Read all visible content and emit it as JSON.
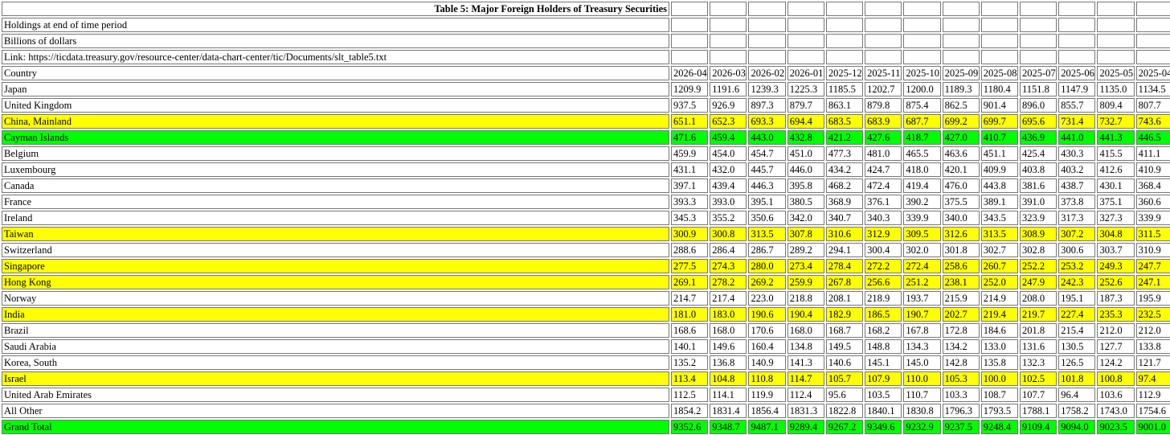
{
  "table": {
    "title": "Table 5: Major Foreign Holders of Treasury Securities",
    "meta": [
      "Holdings at end of time period",
      "Billions of dollars",
      "Link: https://ticdata.treasury.gov/resource-center/data-chart-center/tic/Documents/slt_table5.txt"
    ],
    "header_first": "Country",
    "columns": [
      "2026-04",
      "2026-03",
      "2026-02",
      "2026-01",
      "2025-12",
      "2025-11",
      "2025-10",
      "2025-09",
      "2025-08",
      "2025-07",
      "2025-06",
      "2025-05",
      "2025-04"
    ],
    "highlight_colors": {
      "yellow": "#ffff00",
      "green": "#00ff00"
    },
    "rows": [
      {
        "country": "Japan",
        "highlight": "none",
        "values": [
          "1209.9",
          "1191.6",
          "1239.3",
          "1225.3",
          "1185.5",
          "1202.7",
          "1200.0",
          "1189.3",
          "1180.4",
          "1151.8",
          "1147.9",
          "1135.0",
          "1134.5"
        ]
      },
      {
        "country": "United Kingdom",
        "highlight": "none",
        "values": [
          "937.5",
          "926.9",
          "897.3",
          "879.7",
          "863.1",
          "879.8",
          "875.4",
          "862.5",
          "901.4",
          "896.0",
          "855.7",
          "809.4",
          "807.7"
        ]
      },
      {
        "country": "China, Mainland",
        "highlight": "yellow",
        "values": [
          "651.1",
          "652.3",
          "693.3",
          "694.4",
          "683.5",
          "683.9",
          "687.7",
          "699.2",
          "699.7",
          "695.6",
          "731.4",
          "732.7",
          "743.6"
        ]
      },
      {
        "country": "Cayman Islands",
        "highlight": "green",
        "values": [
          "471.6",
          "459.4",
          "443.0",
          "432.8",
          "421.2",
          "427.6",
          "418.7",
          "427.0",
          "410.7",
          "436.9",
          "441.0",
          "441.3",
          "446.5"
        ]
      },
      {
        "country": "Belgium",
        "highlight": "none",
        "values": [
          "459.9",
          "454.0",
          "454.7",
          "451.0",
          "477.3",
          "481.0",
          "465.5",
          "463.6",
          "451.1",
          "425.4",
          "430.3",
          "415.5",
          "411.1"
        ]
      },
      {
        "country": "Luxembourg",
        "highlight": "none",
        "values": [
          "431.1",
          "432.0",
          "445.7",
          "446.0",
          "434.2",
          "424.7",
          "418.0",
          "420.1",
          "409.9",
          "403.8",
          "403.2",
          "412.6",
          "410.9"
        ]
      },
      {
        "country": "Canada",
        "highlight": "none",
        "values": [
          "397.1",
          "439.4",
          "446.3",
          "395.8",
          "468.2",
          "472.4",
          "419.4",
          "476.0",
          "443.8",
          "381.6",
          "438.7",
          "430.1",
          "368.4"
        ]
      },
      {
        "country": "France",
        "highlight": "none",
        "values": [
          "393.3",
          "393.0",
          "395.1",
          "380.5",
          "368.9",
          "376.1",
          "390.2",
          "375.5",
          "389.1",
          "391.0",
          "373.8",
          "375.1",
          "360.6"
        ]
      },
      {
        "country": "Ireland",
        "highlight": "none",
        "values": [
          "345.3",
          "355.2",
          "350.6",
          "342.0",
          "340.7",
          "340.3",
          "339.9",
          "340.0",
          "343.5",
          "323.9",
          "317.3",
          "327.3",
          "339.9"
        ]
      },
      {
        "country": "Taiwan",
        "highlight": "yellow",
        "values": [
          "300.9",
          "300.8",
          "313.5",
          "307.8",
          "310.6",
          "312.9",
          "309.5",
          "312.6",
          "313.5",
          "308.9",
          "307.2",
          "304.8",
          "311.5"
        ]
      },
      {
        "country": "Switzerland",
        "highlight": "none",
        "values": [
          "288.6",
          "286.4",
          "286.7",
          "289.2",
          "294.1",
          "300.4",
          "302.0",
          "301.8",
          "302.7",
          "302.8",
          "300.6",
          "303.7",
          "310.9"
        ]
      },
      {
        "country": "Singapore",
        "highlight": "yellow",
        "values": [
          "277.5",
          "274.3",
          "280.0",
          "273.4",
          "278.4",
          "272.2",
          "272.4",
          "258.6",
          "260.7",
          "252.2",
          "253.2",
          "249.3",
          "247.7"
        ]
      },
      {
        "country": "Hong Kong",
        "highlight": "yellow",
        "values": [
          "269.1",
          "278.2",
          "269.2",
          "259.9",
          "267.8",
          "256.6",
          "251.2",
          "238.1",
          "252.0",
          "247.9",
          "242.3",
          "252.6",
          "247.1"
        ]
      },
      {
        "country": "Norway",
        "highlight": "none",
        "values": [
          "214.7",
          "217.4",
          "223.0",
          "218.8",
          "208.1",
          "218.9",
          "193.7",
          "215.9",
          "214.9",
          "208.0",
          "195.1",
          "187.3",
          "195.9"
        ]
      },
      {
        "country": "India",
        "highlight": "yellow",
        "values": [
          "181.0",
          "183.0",
          "190.6",
          "190.4",
          "182.9",
          "186.5",
          "190.7",
          "202.7",
          "219.4",
          "219.7",
          "227.4",
          "235.3",
          "232.5"
        ]
      },
      {
        "country": "Brazil",
        "highlight": "none",
        "values": [
          "168.6",
          "168.0",
          "170.6",
          "168.0",
          "168.7",
          "168.2",
          "167.8",
          "172.8",
          "184.6",
          "201.8",
          "215.4",
          "212.0",
          "212.0"
        ]
      },
      {
        "country": "Saudi Arabia",
        "highlight": "none",
        "values": [
          "140.1",
          "149.6",
          "160.4",
          "134.8",
          "149.5",
          "148.8",
          "134.3",
          "134.2",
          "133.0",
          "131.6",
          "130.5",
          "127.7",
          "133.8"
        ]
      },
      {
        "country": "Korea, South",
        "highlight": "none",
        "values": [
          "135.2",
          "136.8",
          "140.9",
          "141.3",
          "140.6",
          "145.1",
          "145.0",
          "142.8",
          "135.8",
          "132.3",
          "126.5",
          "124.2",
          "121.7"
        ]
      },
      {
        "country": "Israel",
        "highlight": "yellow",
        "values": [
          "113.4",
          "104.8",
          "110.8",
          "114.7",
          "105.7",
          "107.9",
          "110.0",
          "105.3",
          "100.0",
          "102.5",
          "101.8",
          "100.8",
          "97.4"
        ]
      },
      {
        "country": "United Arab Emirates",
        "highlight": "none",
        "values": [
          "112.5",
          "114.1",
          "119.9",
          "112.4",
          "95.6",
          "103.5",
          "110.7",
          "103.3",
          "108.7",
          "107.7",
          "96.4",
          "103.6",
          "112.9"
        ]
      },
      {
        "country": "All Other",
        "highlight": "none",
        "values": [
          "1854.2",
          "1831.4",
          "1856.4",
          "1831.3",
          "1822.8",
          "1840.1",
          "1830.8",
          "1796.3",
          "1793.5",
          "1788.1",
          "1758.2",
          "1743.0",
          "1754.6"
        ]
      },
      {
        "country": "Grand Total",
        "highlight": "green",
        "values": [
          "9352.6",
          "9348.7",
          "9487.1",
          "9289.4",
          "9267.2",
          "9349.6",
          "9232.9",
          "9237.5",
          "9248.4",
          "9109.4",
          "9094.0",
          "9023.5",
          "9001.0"
        ]
      }
    ]
  }
}
